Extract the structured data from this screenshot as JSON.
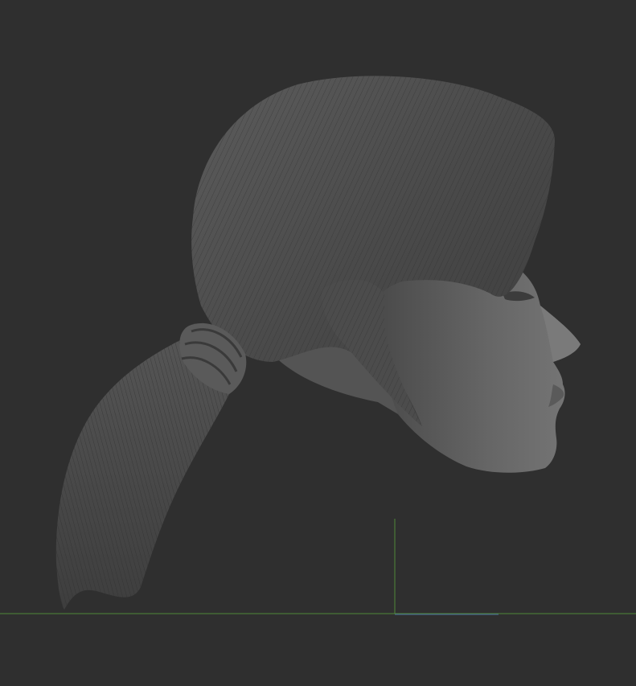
{
  "viewport": {
    "background_color": "#2f2f2f",
    "model": {
      "name": "female-head-ponytail-sculpt",
      "material_color": "#6a6a6a",
      "shadow_color": "#3a3a3a",
      "highlight_color": "#8c8c8c"
    },
    "axes": {
      "x_axis_color": "#4f8a3a",
      "y_axis_color": "#4f8a3a",
      "z_axis_color": "#4a6aa0"
    }
  }
}
